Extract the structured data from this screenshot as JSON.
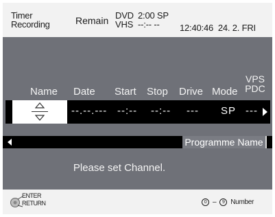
{
  "header": {
    "title_line1": "Timer",
    "title_line2": "Recording",
    "remain_label": "Remain",
    "dvd_label": "DVD",
    "vhs_label": "VHS",
    "dvd_value": "2:00 SP",
    "vhs_value": "--:-- --",
    "time": "12:40:46",
    "date": "24. 2. FRI"
  },
  "columns": {
    "name": "Name",
    "date": "Date",
    "start": "Start",
    "stop": "Stop",
    "drive": "Drive",
    "mode": "Mode",
    "vps_line1": "VPS",
    "vps_line2": "PDC"
  },
  "row": {
    "date": "--.--.---",
    "start": "--:--",
    "stop": "--:--",
    "drive": "---",
    "mode": "SP",
    "vps": "---"
  },
  "programme_name_label": "Programme Name",
  "message": "Please set Channel.",
  "footer": {
    "enter_label": "ENTER",
    "return_label": "RETURN",
    "num_from": "0",
    "num_dash": "–",
    "num_to": "9",
    "num_label": "Number"
  },
  "colors": {
    "panel": "#6f7178",
    "bar": "#000000",
    "header": "#f2f2f2",
    "selected_cell": "#ffffff"
  }
}
